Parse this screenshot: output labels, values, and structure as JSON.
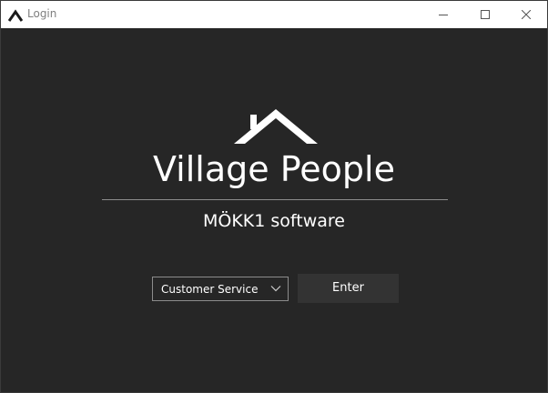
{
  "window": {
    "title": "Login",
    "controls": [
      "minimize-icon",
      "maximize-icon",
      "close-icon"
    ]
  },
  "brand": {
    "logo_icon": "house-roof-icon",
    "title": "Village People",
    "subtitle": "MÖKK1 software"
  },
  "form": {
    "role_select": {
      "selected": "Customer Service",
      "icon": "chevron-down-icon"
    },
    "enter_label": "Enter"
  },
  "colors": {
    "background": "#262626",
    "titlebar": "#ffffff",
    "text": "#ffffff",
    "button": "#333333",
    "divider": "#8c8c8c"
  }
}
